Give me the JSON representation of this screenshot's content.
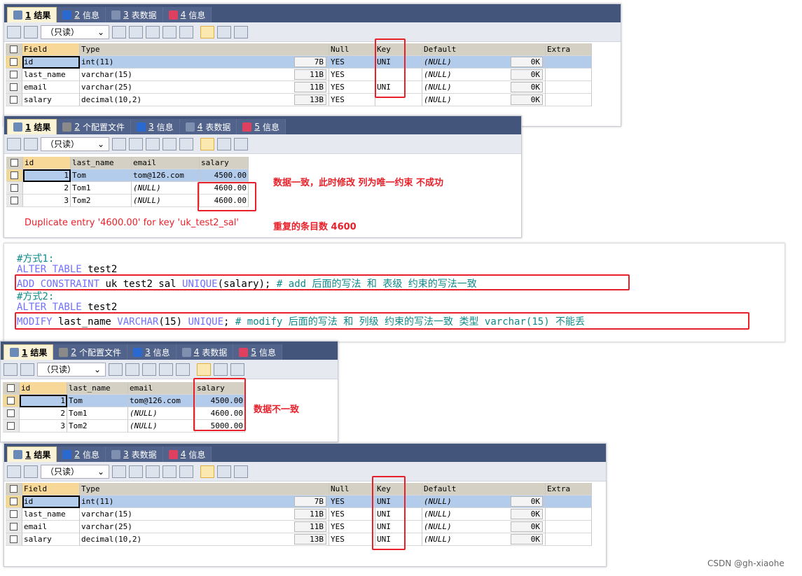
{
  "colors": {
    "tab_bar": "#43557a",
    "annotation": "#e8202a",
    "keyword": "#7070ff",
    "comment": "#108a8a",
    "selected_row": "#b4cceb"
  },
  "toolbar": {
    "mode_select": "（只读）"
  },
  "structure_tabs": [
    {
      "num": "1",
      "label": "结果",
      "icon": "result-grid-icon"
    },
    {
      "num": "2",
      "label": "信息",
      "icon": "info-icon"
    },
    {
      "num": "3",
      "label": "表数据",
      "icon": "table-data-icon"
    },
    {
      "num": "4",
      "label": "信息",
      "icon": "info-chart-icon"
    }
  ],
  "data_tabs": [
    {
      "num": "1",
      "label": "结果",
      "icon": "result-grid-icon"
    },
    {
      "num": "2",
      "label": "个配置文件",
      "icon": "profile-icon"
    },
    {
      "num": "3",
      "label": "信息",
      "icon": "info-icon"
    },
    {
      "num": "4",
      "label": "表数据",
      "icon": "table-data-icon"
    },
    {
      "num": "5",
      "label": "信息",
      "icon": "info-chart-icon"
    }
  ],
  "structure_columns": [
    "Field",
    "Type",
    "Null",
    "Key",
    "Default",
    "Extra"
  ],
  "structure_before": [
    {
      "field": "id",
      "type": "int(11)",
      "size": "7B",
      "null": "YES",
      "key": "UNI",
      "default": "(NULL)",
      "def_size": "0K",
      "extra": ""
    },
    {
      "field": "last_name",
      "type": "varchar(15)",
      "size": "11B",
      "null": "YES",
      "key": "",
      "default": "(NULL)",
      "def_size": "0K",
      "extra": ""
    },
    {
      "field": "email",
      "type": "varchar(25)",
      "size": "11B",
      "null": "YES",
      "key": "UNI",
      "default": "(NULL)",
      "def_size": "0K",
      "extra": ""
    },
    {
      "field": "salary",
      "type": "decimal(10,2)",
      "size": "13B",
      "null": "YES",
      "key": "",
      "default": "(NULL)",
      "def_size": "0K",
      "extra": ""
    }
  ],
  "structure_after": [
    {
      "field": "id",
      "type": "int(11)",
      "size": "7B",
      "null": "YES",
      "key": "UNI",
      "default": "(NULL)",
      "def_size": "0K",
      "extra": ""
    },
    {
      "field": "last_name",
      "type": "varchar(15)",
      "size": "11B",
      "null": "YES",
      "key": "UNI",
      "default": "(NULL)",
      "def_size": "0K",
      "extra": ""
    },
    {
      "field": "email",
      "type": "varchar(25)",
      "size": "11B",
      "null": "YES",
      "key": "UNI",
      "default": "(NULL)",
      "def_size": "0K",
      "extra": ""
    },
    {
      "field": "salary",
      "type": "decimal(10,2)",
      "size": "13B",
      "null": "YES",
      "key": "UNI",
      "default": "(NULL)",
      "def_size": "0K",
      "extra": ""
    }
  ],
  "data_columns": [
    "id",
    "last_name",
    "email",
    "salary"
  ],
  "data_dup": [
    {
      "id": "1",
      "last_name": "Tom",
      "email": "tom@126.com",
      "salary": "4500.00"
    },
    {
      "id": "2",
      "last_name": "Tom1",
      "email": "(NULL)",
      "salary": "4600.00"
    },
    {
      "id": "3",
      "last_name": "Tom2",
      "email": "(NULL)",
      "salary": "4600.00"
    }
  ],
  "data_ok": [
    {
      "id": "1",
      "last_name": "Tom",
      "email": "tom@126.com",
      "salary": "4500.00"
    },
    {
      "id": "2",
      "last_name": "Tom1",
      "email": "(NULL)",
      "salary": "4600.00"
    },
    {
      "id": "3",
      "last_name": "Tom2",
      "email": "(NULL)",
      "salary": "5000.00"
    }
  ],
  "notes": {
    "consistent": "数据一致，此时修改 列为唯一约束 不成功",
    "duplicate_error": "Duplicate entry '4600.00' for key 'uk_test2_sal'",
    "dup_count": "重复的条目数 4600",
    "inconsistent": "数据不一致"
  },
  "code": {
    "c1": "#方式1:",
    "l2a": "ALTER TABLE",
    "l2b": " test2",
    "l3a": "ADD CONSTRAINT",
    "l3b": " uk_test2_sal ",
    "l3c": "UNIQUE",
    "l3d": "(salary); ",
    "l3e": "# add 后面的写法 和 表级 约束的写法一致",
    "c2": "#方式2:",
    "l5a": "ALTER TABLE",
    "l5b": " test2",
    "l6a": "MODIFY",
    "l6b": " last_name ",
    "l6c": "VARCHAR",
    "l6d": "(15) ",
    "l6e": "UNIQUE",
    "l6f": "; ",
    "l6g": "# modify 后面的写法 和 列级 约束的写法一致 类型 varchar(15) 不能丢"
  },
  "watermark": "CSDN @gh-xiaohe"
}
